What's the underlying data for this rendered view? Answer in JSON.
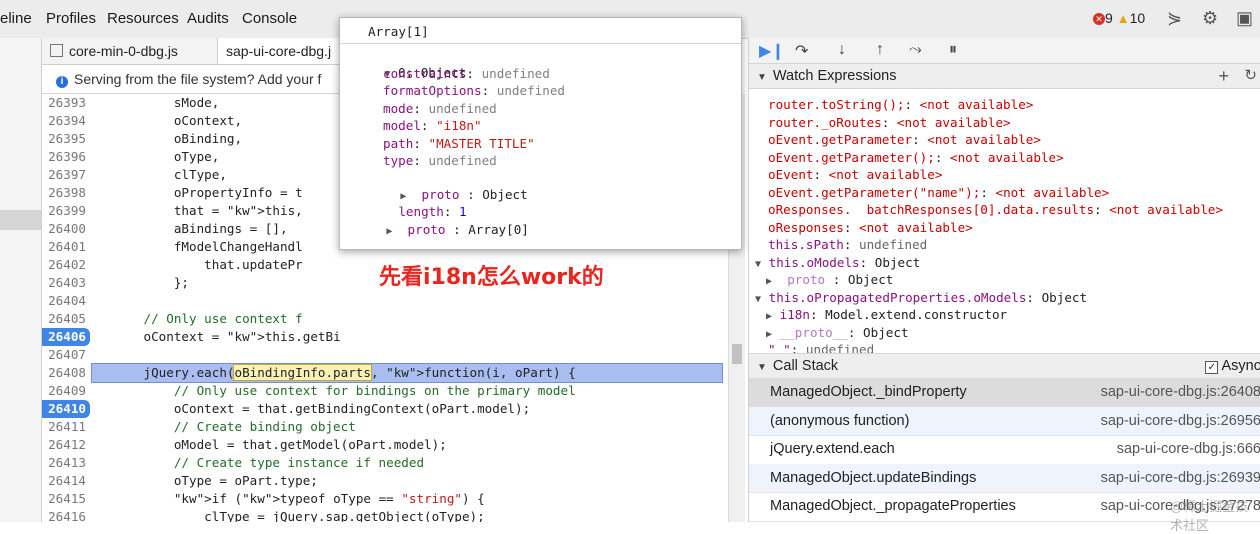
{
  "top_tabs": [
    "eline",
    "Profiles",
    "Resources",
    "Audits",
    "Console"
  ],
  "counts": {
    "errors": "9",
    "warnings": "10"
  },
  "file_tabs": [
    "core-min-0-dbg.js",
    "sap-ui-core-dbg.j"
  ],
  "info_bar": "Serving from the file system? Add your f",
  "code_lines": [
    {
      "n": "26393",
      "t": "sMode,"
    },
    {
      "n": "26394",
      "t": "oContext,"
    },
    {
      "n": "26395",
      "t": "oBinding,"
    },
    {
      "n": "26396",
      "t": "oType,"
    },
    {
      "n": "26397",
      "t": "clType,"
    },
    {
      "n": "26398",
      "t": "oPropertyInfo = t"
    },
    {
      "n": "26399",
      "t": "that = this,"
    },
    {
      "n": "26400",
      "t": "aBindings = [],"
    },
    {
      "n": "26401",
      "t": "fModelChangeHandl"
    },
    {
      "n": "26402",
      "t": "that.updatePr"
    },
    {
      "n": "26403",
      "t": "};"
    },
    {
      "n": "26404",
      "t": ""
    },
    {
      "n": "26405",
      "t": "// Only use context f"
    },
    {
      "n": "26406",
      "t": "oContext = this.getBi"
    },
    {
      "n": "26407",
      "t": ""
    },
    {
      "n": "26408",
      "t": "jQuery.each(oBindingInfo.parts, function(i, oPart) {"
    },
    {
      "n": "26409",
      "t": "// Only use context for bindings on the primary model"
    },
    {
      "n": "26410",
      "t": "oContext = that.getBindingContext(oPart.model);"
    },
    {
      "n": "26411",
      "t": "// Create binding object"
    },
    {
      "n": "26412",
      "t": "oModel = that.getModel(oPart.model);"
    },
    {
      "n": "26413",
      "t": "// Create type instance if needed"
    },
    {
      "n": "26414",
      "t": "oType = oPart.type;"
    },
    {
      "n": "26415",
      "t": "if (typeof oType == \"string\") {"
    },
    {
      "n": "26416",
      "t": "clType = jQuery.sap.getObject(oType);"
    }
  ],
  "popover": {
    "title": "Array[1]",
    "root": "0: Object",
    "props": [
      {
        "k": "constraints",
        "v": "undefined"
      },
      {
        "k": "formatOptions",
        "v": "undefined"
      },
      {
        "k": "mode",
        "v": "undefined"
      },
      {
        "k": "model",
        "v": "\"i18n\""
      },
      {
        "k": "path",
        "v": "\"MASTER TITLE\""
      },
      {
        "k": "type",
        "v": "undefined"
      }
    ],
    "proto_inner": "proto",
    "proto_inner_val": ": Object",
    "length_k": "length",
    "length_v": "1",
    "proto_outer": "proto",
    "proto_outer_val": ": Array[0]"
  },
  "annotation": "先看i18n怎么work的",
  "watch_title": "Watch Expressions",
  "watch": [
    {
      "e": "router.toString();",
      "v": "<not available>"
    },
    {
      "e": "router._oRoutes",
      "v": "<not available>"
    },
    {
      "e": "oEvent.getParameter",
      "v": "<not available>"
    },
    {
      "e": "oEvent.getParameter();",
      "v": "<not available>"
    },
    {
      "e": "oEvent",
      "v": "<not available>"
    },
    {
      "e": "oEvent.getParameter(\"name\");",
      "v": "<not available>"
    },
    {
      "e": "oResponses.  batchResponses[0].data.results",
      "v": "<not available>"
    },
    {
      "e": "oResponses",
      "v": "<not available>"
    }
  ],
  "watch_objs": [
    {
      "e": "this.sPath",
      "v": "undefined"
    },
    {
      "e": "this.oModels",
      "v": "Object"
    },
    {
      "e": "proto",
      "v": ": Object"
    },
    {
      "e": "this.oPropagatedProperties.oModels",
      "v": "Object"
    },
    {
      "e": "i18n",
      "v": "Model.extend.constructor"
    },
    {
      "e": "__proto__",
      "v": "Object"
    },
    {
      "e": "\" \"",
      "v": "undefined"
    }
  ],
  "callstack_title": "Call Stack",
  "async_label": "Async",
  "stack": [
    {
      "fn": "ManagedObject._bindProperty",
      "loc": "sap-ui-core-dbg.js:26408"
    },
    {
      "fn": "(anonymous function)",
      "loc": "sap-ui-core-dbg.js:26956"
    },
    {
      "fn": "jQuery.extend.each",
      "loc": "sap-ui-core-dbg.js:666"
    },
    {
      "fn": "ManagedObject.updateBindings",
      "loc": "sap-ui-core-dbg.js:26939"
    },
    {
      "fn": "ManagedObject._propagateProperties",
      "loc": "sap-ui-core-dbg.js:27278"
    }
  ],
  "watermark": "@稀土掘金技术社区"
}
